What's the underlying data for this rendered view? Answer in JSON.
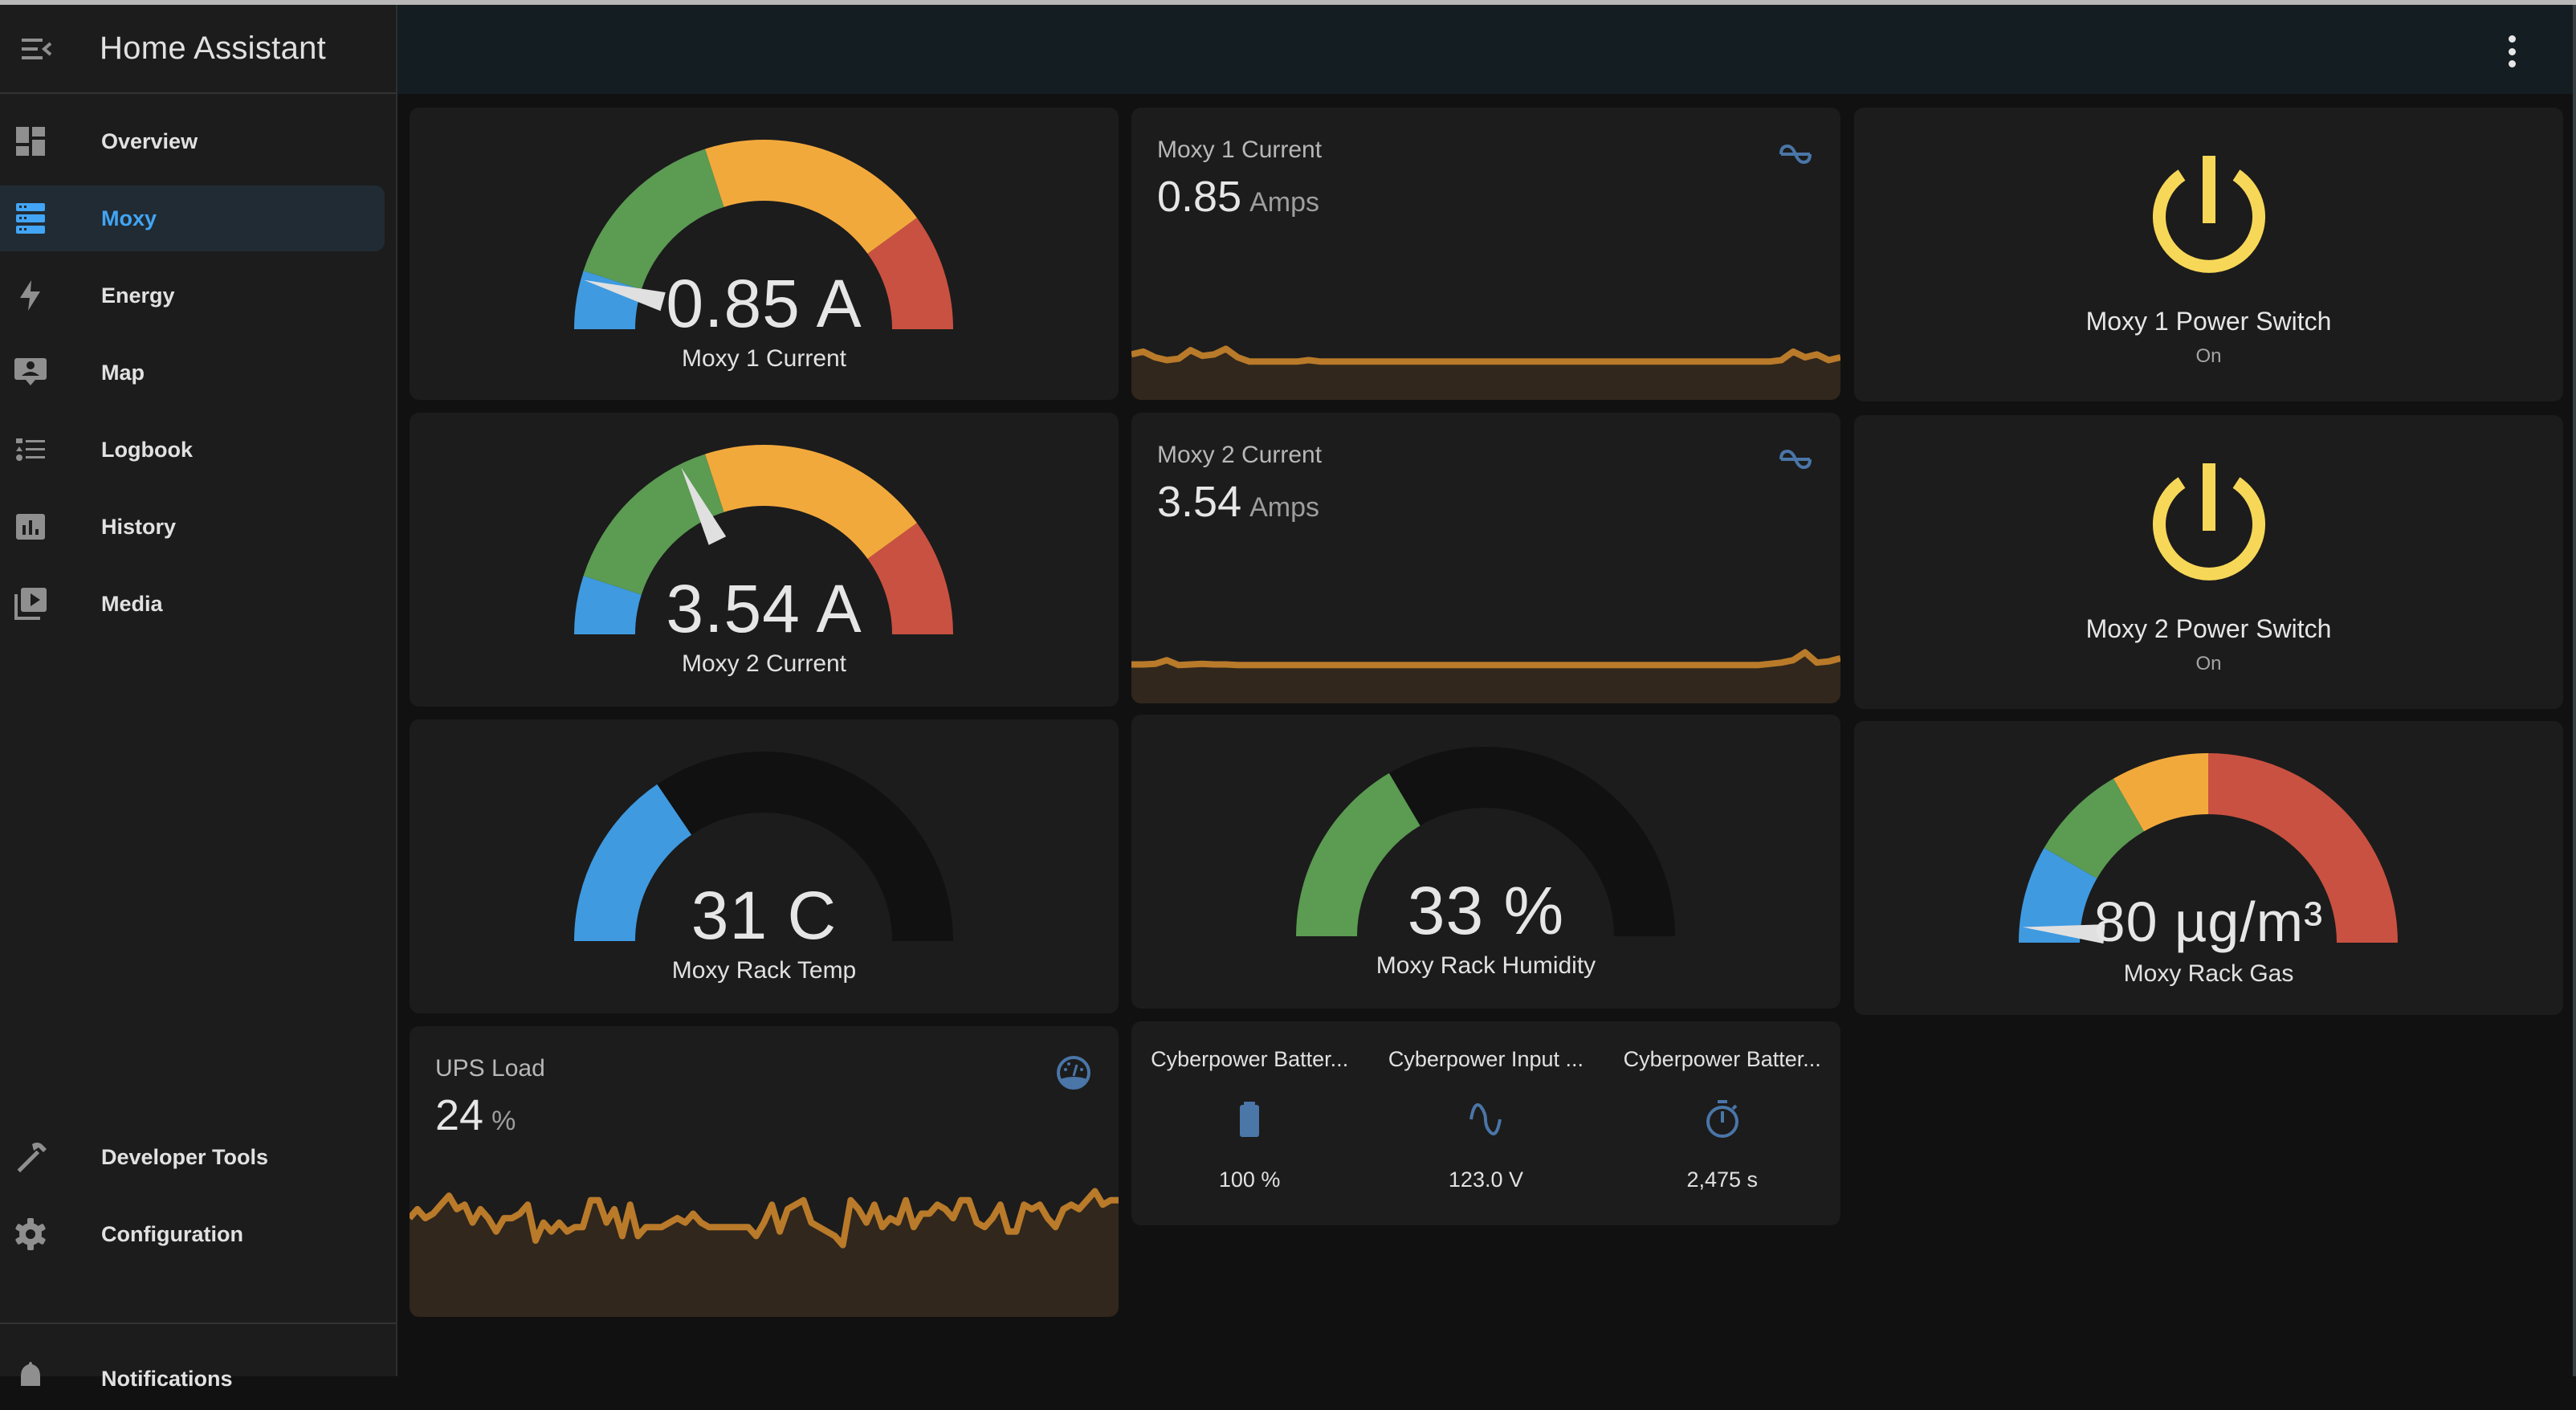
{
  "app": {
    "title": "Home Assistant"
  },
  "sidebar": {
    "items": [
      {
        "label": "Overview",
        "icon": "view-dashboard-icon",
        "active": false
      },
      {
        "label": "Moxy",
        "icon": "server-icon",
        "active": true
      },
      {
        "label": "Energy",
        "icon": "lightning-bolt-icon",
        "active": false
      },
      {
        "label": "Map",
        "icon": "map-account-icon",
        "active": false
      },
      {
        "label": "Logbook",
        "icon": "format-list-icon",
        "active": false
      },
      {
        "label": "History",
        "icon": "chart-box-icon",
        "active": false
      },
      {
        "label": "Media",
        "icon": "play-box-multiple-icon",
        "active": false
      }
    ],
    "bottom_items": [
      {
        "label": "Developer Tools",
        "icon": "hammer-icon"
      },
      {
        "label": "Configuration",
        "icon": "cog-icon"
      }
    ],
    "notifications_label": "Notifications"
  },
  "colors": {
    "accent": "#42a5f5",
    "gauge_blue": "#3f9ae0",
    "gauge_green": "#5b9b52",
    "gauge_orange": "#f2a93c",
    "gauge_red": "#c95141",
    "gauge_empty": "#111111",
    "spark_line": "#b97a2a",
    "spark_fill": "#31271c",
    "switch_on": "#f7d757",
    "icon_blue": "#4a76a8"
  },
  "cards": {
    "moxy1_gauge": {
      "value_text": "0.85 A",
      "name": "Moxy 1 Current",
      "value": 0.85,
      "min": 0,
      "max": 10,
      "needle": true,
      "segments": [
        {
          "from": 0,
          "to": 1,
          "color": "blue"
        },
        {
          "from": 1,
          "to": 4,
          "color": "green"
        },
        {
          "from": 4,
          "to": 8,
          "color": "orange"
        },
        {
          "from": 8,
          "to": 10,
          "color": "red"
        }
      ]
    },
    "moxy2_gauge": {
      "value_text": "3.54 A",
      "name": "Moxy 2 Current",
      "value": 3.54,
      "min": 0,
      "max": 10,
      "needle": true,
      "segments": [
        {
          "from": 0,
          "to": 1,
          "color": "blue"
        },
        {
          "from": 1,
          "to": 4,
          "color": "green"
        },
        {
          "from": 4,
          "to": 8,
          "color": "orange"
        },
        {
          "from": 8,
          "to": 10,
          "color": "red"
        }
      ]
    },
    "temp_gauge": {
      "value_text": "31 C",
      "name": "Moxy Rack Temp",
      "value": 31,
      "min": 0,
      "max": 100,
      "needle": false,
      "fill_color": "blue"
    },
    "humidity_gauge": {
      "value_text": "33 %",
      "name": "Moxy Rack Humidity",
      "value": 33,
      "min": 0,
      "max": 100,
      "needle": false,
      "fill_color": "green"
    },
    "gas_gauge": {
      "value_text": "80 µg/m³",
      "name": "Moxy Rack Gas",
      "value": 80,
      "min": 0,
      "max": 3000,
      "needle": true,
      "segments": [
        {
          "from": 0,
          "to": 500,
          "color": "blue"
        },
        {
          "from": 500,
          "to": 1000,
          "color": "green"
        },
        {
          "from": 1000,
          "to": 1500,
          "color": "orange"
        },
        {
          "from": 1500,
          "to": 3000,
          "color": "red"
        }
      ]
    },
    "moxy1_sensor": {
      "name": "Moxy 1 Current",
      "value": "0.85",
      "unit": "Amps",
      "icon": "current-ac-icon",
      "history": [
        0.9,
        0.92,
        0.88,
        0.86,
        0.87,
        0.93,
        0.89,
        0.9,
        0.94,
        0.88,
        0.85,
        0.85,
        0.85,
        0.85,
        0.85,
        0.86,
        0.85,
        0.85,
        0.85,
        0.85,
        0.85,
        0.85,
        0.85,
        0.85,
        0.85,
        0.85,
        0.85,
        0.85,
        0.85,
        0.85,
        0.85,
        0.85,
        0.85,
        0.85,
        0.85,
        0.85,
        0.85,
        0.85,
        0.85,
        0.85,
        0.85,
        0.85,
        0.85,
        0.85,
        0.85,
        0.85,
        0.85,
        0.85,
        0.85,
        0.85,
        0.85,
        0.85,
        0.85,
        0.85,
        0.85,
        0.86,
        0.92,
        0.88,
        0.9,
        0.86,
        0.88
      ]
    },
    "moxy2_sensor": {
      "name": "Moxy 2 Current",
      "value": "3.54",
      "unit": "Amps",
      "icon": "current-ac-icon",
      "history": [
        3.55,
        3.55,
        3.56,
        3.62,
        3.54,
        3.55,
        3.56,
        3.55,
        3.55,
        3.54,
        3.54,
        3.54,
        3.54,
        3.54,
        3.54,
        3.54,
        3.54,
        3.54,
        3.54,
        3.54,
        3.54,
        3.54,
        3.54,
        3.54,
        3.54,
        3.54,
        3.54,
        3.54,
        3.54,
        3.54,
        3.54,
        3.54,
        3.54,
        3.54,
        3.54,
        3.54,
        3.54,
        3.54,
        3.54,
        3.54,
        3.54,
        3.54,
        3.54,
        3.54,
        3.54,
        3.54,
        3.54,
        3.54,
        3.54,
        3.54,
        3.54,
        3.54,
        3.54,
        3.54,
        3.56,
        3.58,
        3.62,
        3.75,
        3.58,
        3.6,
        3.65
      ]
    },
    "moxy1_switch": {
      "name": "Moxy 1 Power Switch",
      "state": "On",
      "icon": "power-icon"
    },
    "moxy2_switch": {
      "name": "Moxy 2 Power Switch",
      "state": "On",
      "icon": "power-icon"
    },
    "ups_load": {
      "name": "UPS Load",
      "value": "24",
      "unit": "%",
      "icon": "gauge-icon",
      "history": [
        22,
        24,
        22,
        23,
        25,
        27,
        24,
        25,
        21,
        24,
        22,
        19,
        22,
        22,
        23,
        25,
        17,
        21,
        19,
        21,
        19,
        20,
        20,
        26,
        26,
        21,
        24,
        18,
        25,
        18,
        20,
        20,
        20,
        21,
        22,
        21,
        23,
        21,
        20,
        20,
        20,
        20,
        20,
        20,
        18,
        21,
        25,
        19,
        24,
        25,
        26,
        21,
        20,
        19,
        18,
        16,
        26,
        24,
        21,
        25,
        20,
        22,
        21,
        26,
        20,
        23,
        23,
        25,
        24,
        22,
        26,
        26,
        21,
        20,
        22,
        25,
        19,
        19,
        25,
        24,
        25,
        22,
        20,
        24,
        25,
        24,
        26,
        28,
        25,
        26,
        26
      ]
    },
    "cyberpower": {
      "entities": [
        {
          "name": "Cyberpower Batter...",
          "icon": "battery-icon",
          "state": "100 %"
        },
        {
          "name": "Cyberpower Input ...",
          "icon": "sine-wave-icon",
          "state": "123.0 V"
        },
        {
          "name": "Cyberpower Batter...",
          "icon": "timer-icon",
          "state": "2,475 s"
        }
      ]
    }
  }
}
